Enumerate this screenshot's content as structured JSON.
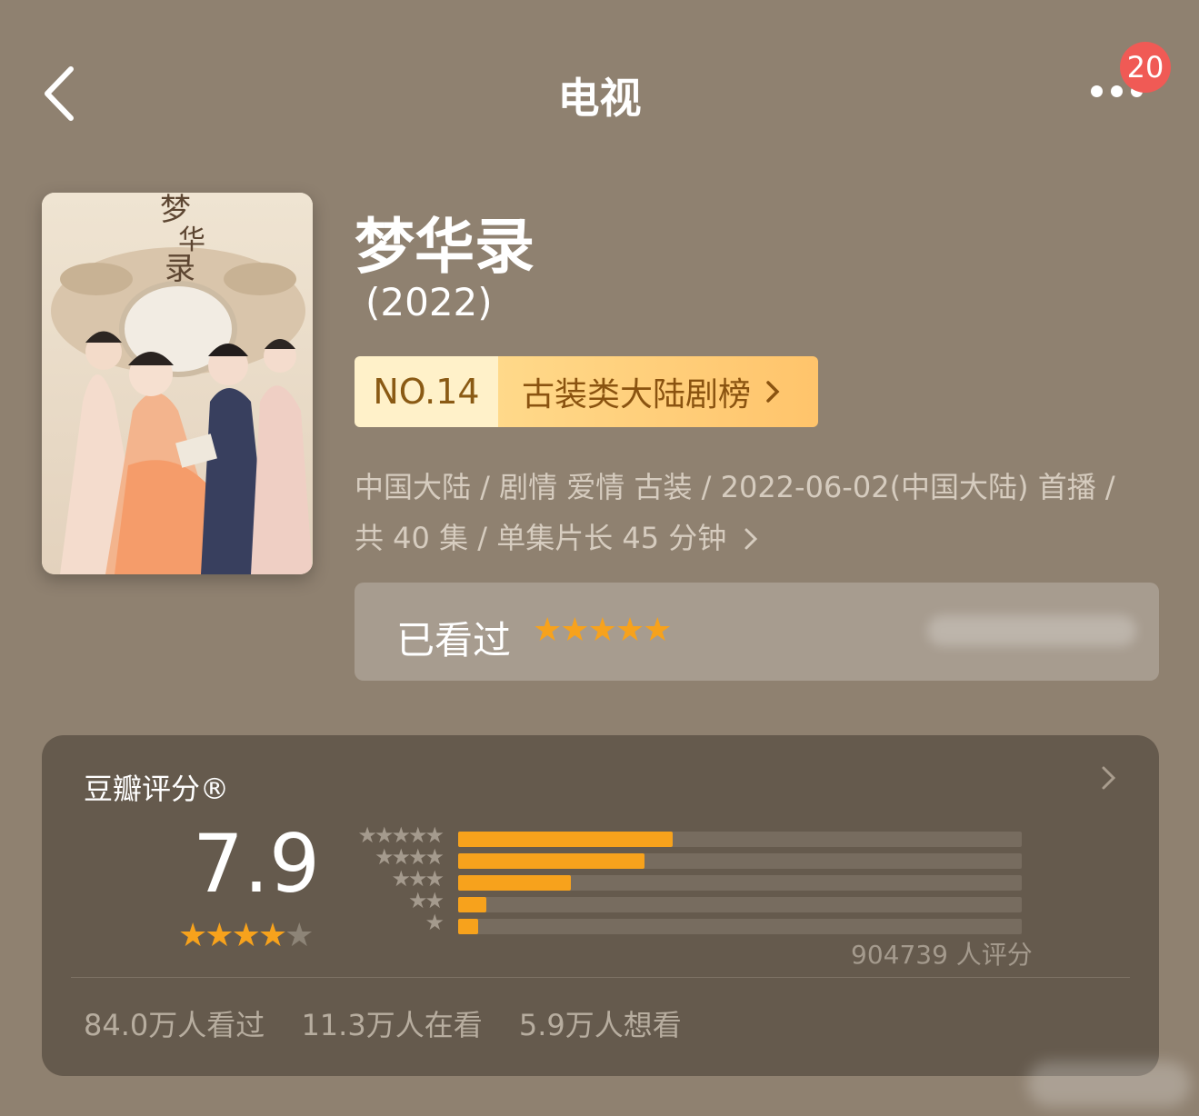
{
  "header": {
    "title": "电视",
    "notification_count": "20"
  },
  "show": {
    "title": "梦华录",
    "year": "(2022)",
    "rank_no": "NO.14",
    "rank_list": "古装类大陆剧榜",
    "meta_line1": "中国大陆 / 剧情 爱情 古装 / 2022-06-02(中国大陆) 首播 /",
    "meta_line2": "共 40 集 / 单集片长 45 分钟",
    "poster_calligraphy": "梦华录"
  },
  "user_rating": {
    "status": "已看过",
    "stars": 5
  },
  "douban": {
    "label": "豆瓣评分®",
    "score": "7.9",
    "stars": 4,
    "distribution": [
      {
        "stars": 5,
        "percent": 38
      },
      {
        "stars": 4,
        "percent": 33
      },
      {
        "stars": 3,
        "percent": 20
      },
      {
        "stars": 2,
        "percent": 5
      },
      {
        "stars": 1,
        "percent": 3.5
      }
    ],
    "count": "904739 人评分",
    "watched": "84.0万人看过",
    "watching": "11.3万人在看",
    "want": "5.9万人想看"
  },
  "colors": {
    "accent": "#f7a21c",
    "background": "#8f8170",
    "card": "#655a4d"
  }
}
